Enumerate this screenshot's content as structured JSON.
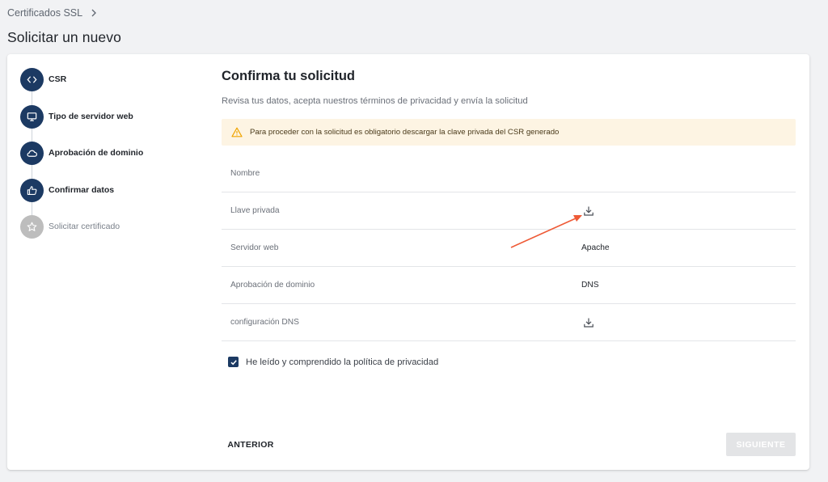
{
  "breadcrumb": {
    "label": "Certificados SSL"
  },
  "page": {
    "title": "Solicitar un nuevo"
  },
  "stepper": {
    "steps": [
      {
        "label": "CSR",
        "icon": "code-icon",
        "state": "completed"
      },
      {
        "label": "Tipo de servidor web",
        "icon": "monitor-icon",
        "state": "completed"
      },
      {
        "label": "Aprobación de dominio",
        "icon": "cloud-icon",
        "state": "completed"
      },
      {
        "label": "Confirmar datos",
        "icon": "thumbs-up-icon",
        "state": "active"
      },
      {
        "label": "Solicitar certificado",
        "icon": "star-icon",
        "state": "pending"
      }
    ]
  },
  "main": {
    "title": "Confirma tu solicitud",
    "subtitle": "Revisa tus datos, acepta nuestros términos de privacidad y envía la solicitud",
    "alert": {
      "text": "Para proceder con la solicitud es obligatorio descargar la clave privada del CSR generado",
      "icon": "warning-icon"
    },
    "rows": [
      {
        "label": "Nombre",
        "value": ""
      },
      {
        "label": "Llave privada",
        "icon": "download-icon"
      },
      {
        "label": "Servidor web",
        "value": "Apache"
      },
      {
        "label": "Aprobación de dominio",
        "value": "DNS"
      },
      {
        "label": "configuración DNS",
        "icon": "download-icon"
      }
    ],
    "privacy_checkbox": {
      "label": "He leído y comprendido la política de privacidad",
      "checked": true
    }
  },
  "actions": {
    "previous_label": "ANTERIOR",
    "next_label": "SIGUIENTE",
    "next_disabled": true
  },
  "colors": {
    "primary": "#1c3a63",
    "inactive": "#bdbdbd",
    "alert_bg": "#fdf4e3",
    "warning": "#f0a400",
    "annotation_arrow": "#ee5a36"
  }
}
